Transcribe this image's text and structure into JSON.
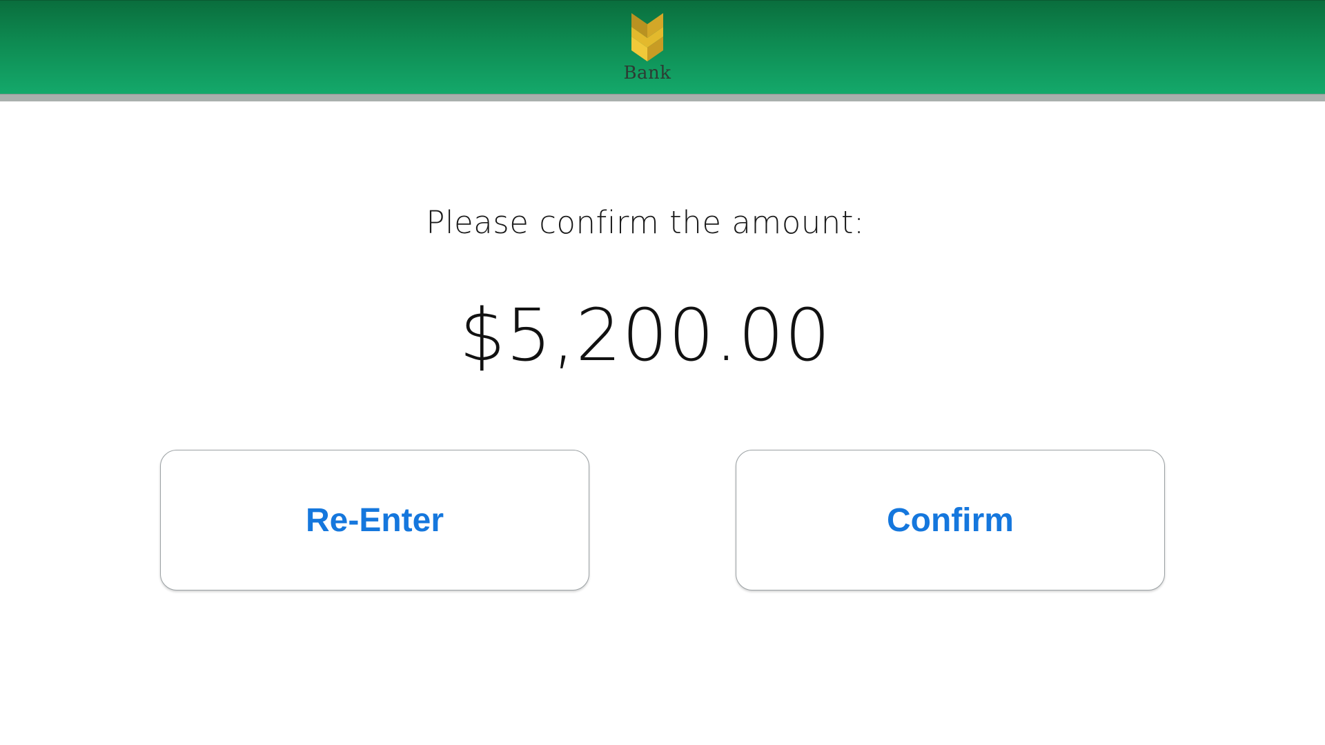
{
  "header": {
    "logo_text": "Bank",
    "colors": {
      "gradient_top": "#0a6e3d",
      "gradient_bottom": "#14a96b",
      "logo_gold": "#e3b92d"
    }
  },
  "main": {
    "prompt": "Please confirm the amount:",
    "amount": "$5,200.00",
    "reenter_label": "Re-Enter",
    "confirm_label": "Confirm",
    "accent_color": "#1577dd"
  }
}
